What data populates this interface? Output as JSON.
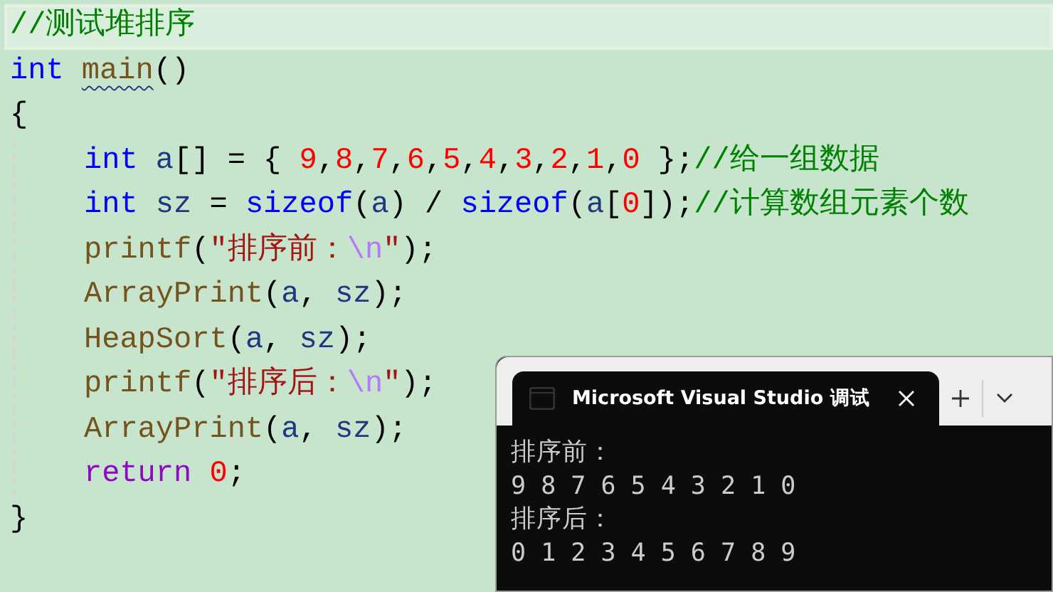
{
  "editor": {
    "lines": [
      {
        "highlighted": true,
        "tokens": [
          {
            "kind": "comment",
            "text": "//测试堆排序"
          }
        ]
      },
      {
        "highlighted": false,
        "tokens": [
          {
            "kind": "keyword",
            "text": "int "
          },
          {
            "kind": "function",
            "text": "main",
            "squiggle": true
          },
          {
            "kind": "plain",
            "text": "()"
          }
        ]
      },
      {
        "highlighted": false,
        "tokens": [
          {
            "kind": "plain",
            "text": "{"
          }
        ],
        "children": [
          {
            "highlighted": false,
            "tokens": [
              {
                "kind": "keyword",
                "text": "int "
              },
              {
                "kind": "variable",
                "text": "a"
              },
              {
                "kind": "plain",
                "text": "[] = { "
              },
              {
                "kind": "number",
                "text": "9"
              },
              {
                "kind": "plain",
                "text": ","
              },
              {
                "kind": "number",
                "text": "8"
              },
              {
                "kind": "plain",
                "text": ","
              },
              {
                "kind": "number",
                "text": "7"
              },
              {
                "kind": "plain",
                "text": ","
              },
              {
                "kind": "number",
                "text": "6"
              },
              {
                "kind": "plain",
                "text": ","
              },
              {
                "kind": "number",
                "text": "5"
              },
              {
                "kind": "plain",
                "text": ","
              },
              {
                "kind": "number",
                "text": "4"
              },
              {
                "kind": "plain",
                "text": ","
              },
              {
                "kind": "number",
                "text": "3"
              },
              {
                "kind": "plain",
                "text": ","
              },
              {
                "kind": "number",
                "text": "2"
              },
              {
                "kind": "plain",
                "text": ","
              },
              {
                "kind": "number",
                "text": "1"
              },
              {
                "kind": "plain",
                "text": ","
              },
              {
                "kind": "number",
                "text": "0"
              },
              {
                "kind": "plain",
                "text": " };"
              },
              {
                "kind": "comment",
                "text": "//给一组数据"
              }
            ]
          },
          {
            "highlighted": false,
            "tokens": [
              {
                "kind": "keyword",
                "text": "int "
              },
              {
                "kind": "variable",
                "text": "sz"
              },
              {
                "kind": "plain",
                "text": " = "
              },
              {
                "kind": "keyword",
                "text": "sizeof"
              },
              {
                "kind": "plain",
                "text": "("
              },
              {
                "kind": "variable",
                "text": "a"
              },
              {
                "kind": "plain",
                "text": ") / "
              },
              {
                "kind": "keyword",
                "text": "sizeof"
              },
              {
                "kind": "plain",
                "text": "("
              },
              {
                "kind": "variable",
                "text": "a"
              },
              {
                "kind": "plain",
                "text": "["
              },
              {
                "kind": "number",
                "text": "0"
              },
              {
                "kind": "plain",
                "text": "]);"
              },
              {
                "kind": "comment",
                "text": "//计算数组元素个数"
              }
            ]
          },
          {
            "highlighted": false,
            "tokens": [
              {
                "kind": "function",
                "text": "printf"
              },
              {
                "kind": "plain",
                "text": "("
              },
              {
                "kind": "string",
                "text": "\"排序前："
              },
              {
                "kind": "escape",
                "text": "\\n"
              },
              {
                "kind": "string",
                "text": "\""
              },
              {
                "kind": "plain",
                "text": ");"
              }
            ]
          },
          {
            "highlighted": false,
            "tokens": [
              {
                "kind": "function",
                "text": "ArrayPrint"
              },
              {
                "kind": "plain",
                "text": "("
              },
              {
                "kind": "variable",
                "text": "a"
              },
              {
                "kind": "plain",
                "text": ", "
              },
              {
                "kind": "variable",
                "text": "sz"
              },
              {
                "kind": "plain",
                "text": ");"
              }
            ]
          },
          {
            "highlighted": false,
            "tokens": [
              {
                "kind": "function",
                "text": "HeapSort"
              },
              {
                "kind": "plain",
                "text": "("
              },
              {
                "kind": "variable",
                "text": "a"
              },
              {
                "kind": "plain",
                "text": ", "
              },
              {
                "kind": "variable",
                "text": "sz"
              },
              {
                "kind": "plain",
                "text": ");"
              }
            ]
          },
          {
            "highlighted": false,
            "tokens": [
              {
                "kind": "function",
                "text": "printf"
              },
              {
                "kind": "plain",
                "text": "("
              },
              {
                "kind": "string",
                "text": "\"排序后："
              },
              {
                "kind": "escape",
                "text": "\\n"
              },
              {
                "kind": "string",
                "text": "\""
              },
              {
                "kind": "plain",
                "text": ");"
              }
            ]
          },
          {
            "highlighted": false,
            "tokens": [
              {
                "kind": "function",
                "text": "ArrayPrint"
              },
              {
                "kind": "plain",
                "text": "("
              },
              {
                "kind": "variable",
                "text": "a"
              },
              {
                "kind": "plain",
                "text": ", "
              },
              {
                "kind": "variable",
                "text": "sz"
              },
              {
                "kind": "plain",
                "text": ");"
              }
            ]
          },
          {
            "highlighted": false,
            "tokens": [
              {
                "kind": "control",
                "text": "return "
              },
              {
                "kind": "number",
                "text": "0"
              },
              {
                "kind": "plain",
                "text": ";"
              }
            ]
          }
        ]
      },
      {
        "highlighted": false,
        "tokens": [
          {
            "kind": "plain",
            "text": "}"
          }
        ]
      }
    ]
  },
  "console": {
    "tab": {
      "title": "Microsoft Visual Studio 调试",
      "selected": true
    },
    "output": [
      "排序前：",
      "9 8 7 6 5 4 3 2 1 0",
      "排序后：",
      "0 1 2 3 4 5 6 7 8 9"
    ]
  }
}
